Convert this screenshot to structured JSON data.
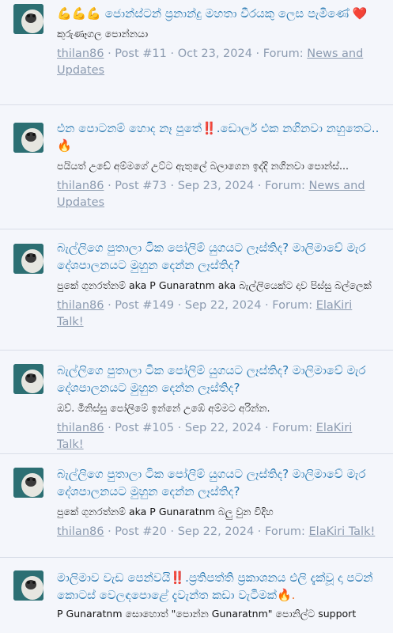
{
  "posts": [
    {
      "title_parts": {
        "lead": "💪💪💪",
        "text": " ජොන්ස්ටන් ප්‍රනාන්දු මහතා වීරයකු ලෙස පැමිණේ ",
        "tail": "❤️"
      },
      "snippet": "කුරුණෑගල පොන්නයා",
      "user": "thilan86",
      "post_no": "Post #11",
      "date": "Oct 23, 2024",
      "forum_label": "Forum:",
      "forum": "News and Updates"
    },
    {
      "title_parts": {
        "lead": "",
        "text": "එන පොටනම් හොද නෑ පුතේ",
        "mark": "‼️",
        "text2": ".ඩොලර් එක නගිනවා නහුතෙට..",
        "tail": "🔥"
      },
      "snippet": "පයියත් උඩේ අම්මගේ උට්ට ඇතුලේ බලාගෙන ඉද්දි නගිනවා පොන්ස්...",
      "user": "thilan86",
      "post_no": "Post #73",
      "date": "Sep 23, 2024",
      "forum_label": "Forum:",
      "forum": "News and Updates"
    },
    {
      "title_parts": {
        "text": "බැල්ලිගෙ පුතාලා ටික පෝලිම් යුගයට ලෑස්තිද? මාලිමාවේ මැර දේශපාලනයට මුහුන දෙන්න ලෑස්තිද?"
      },
      "snippet": "පුකේ ගුනරත්නම් aka P Gunaratnm aka බැල්ලියෙක්ට දාව පිස්සු බල්ලෙක්",
      "user": "thilan86",
      "post_no": "Post #149",
      "date": "Sep 22, 2024",
      "forum_label": "Forum:",
      "forum": "ElaKiri Talk!"
    },
    {
      "title_parts": {
        "text": "බැල්ලිගෙ පුතාලා ටික පෝලිම් යුගයට ලෑස්තිද? මාලිමාවේ මැර දේශපාලනයට මුහුන දෙන්න ලෑස්තිද?"
      },
      "snippet": "ඔව්. මිනිස්සු පෝලිමේ ඉන්නේ උඹේ අම්මට අරින්න.",
      "user": "thilan86",
      "post_no": "Post #105",
      "date": "Sep 22, 2024",
      "forum_label": "Forum:",
      "forum": "ElaKiri Talk!"
    },
    {
      "title_parts": {
        "text": "බැල්ලිගෙ පුතාලා ටික පෝලිම් යුගයට ලෑස්තිද? මාලිමාවේ මැර දේශපාලනයට මුහුන දෙන්න ලෑස්තිද?"
      },
      "snippet": "පුකේ ගුනරත්නම් aka P Gunaratnm බලු වුන විදිහ",
      "user": "thilan86",
      "post_no": "Post #20",
      "date": "Sep 22, 2024",
      "forum_label": "Forum:",
      "forum": "ElaKiri Talk!"
    },
    {
      "title_parts": {
        "text": "මාලිමාව වැඩ පෙන්වයි",
        "mark": "‼️",
        "text2": ".ප්‍රතිපත්ති ප්‍රකාශනය එලි දැක්වූ දා පටන් කොටස් වෙලඳපොළේ දැවැන්ත කඩා වැටීමක්",
        "tail": "🔥."
      },
      "snippet": "P Gunaratnm සොහොත් \"පොන්න Gunaratnm\" පොනිල්ට support",
      "user": "",
      "post_no": "",
      "date": "",
      "forum_label": "",
      "forum": ""
    }
  ],
  "colors": {
    "link": "#2577b1",
    "meta": "#8c9bb0",
    "background": "#f4f6fb",
    "divider": "#d9dee8"
  },
  "icons": {
    "avatar": "pug-avatar-icon"
  }
}
